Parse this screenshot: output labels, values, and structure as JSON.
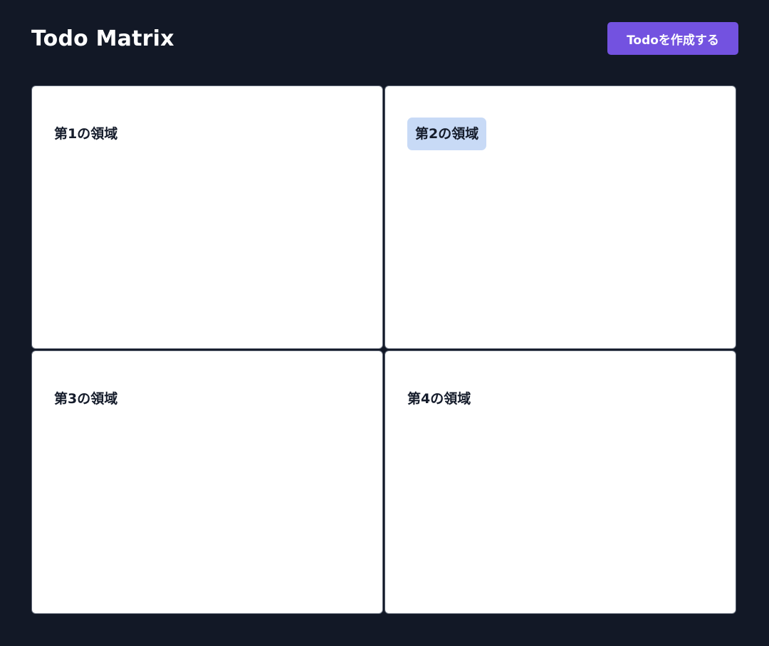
{
  "header": {
    "title": "Todo Matrix",
    "create_button_label": "Todoを作成する"
  },
  "matrix": {
    "quadrants": [
      {
        "label": "第1の領域"
      },
      {
        "label": "第2の領域"
      },
      {
        "label": "第3の領域"
      },
      {
        "label": "第4の領域"
      }
    ]
  },
  "colors": {
    "background": "#121826",
    "accent": "#7352e0",
    "highlight": "#c8daf6"
  }
}
